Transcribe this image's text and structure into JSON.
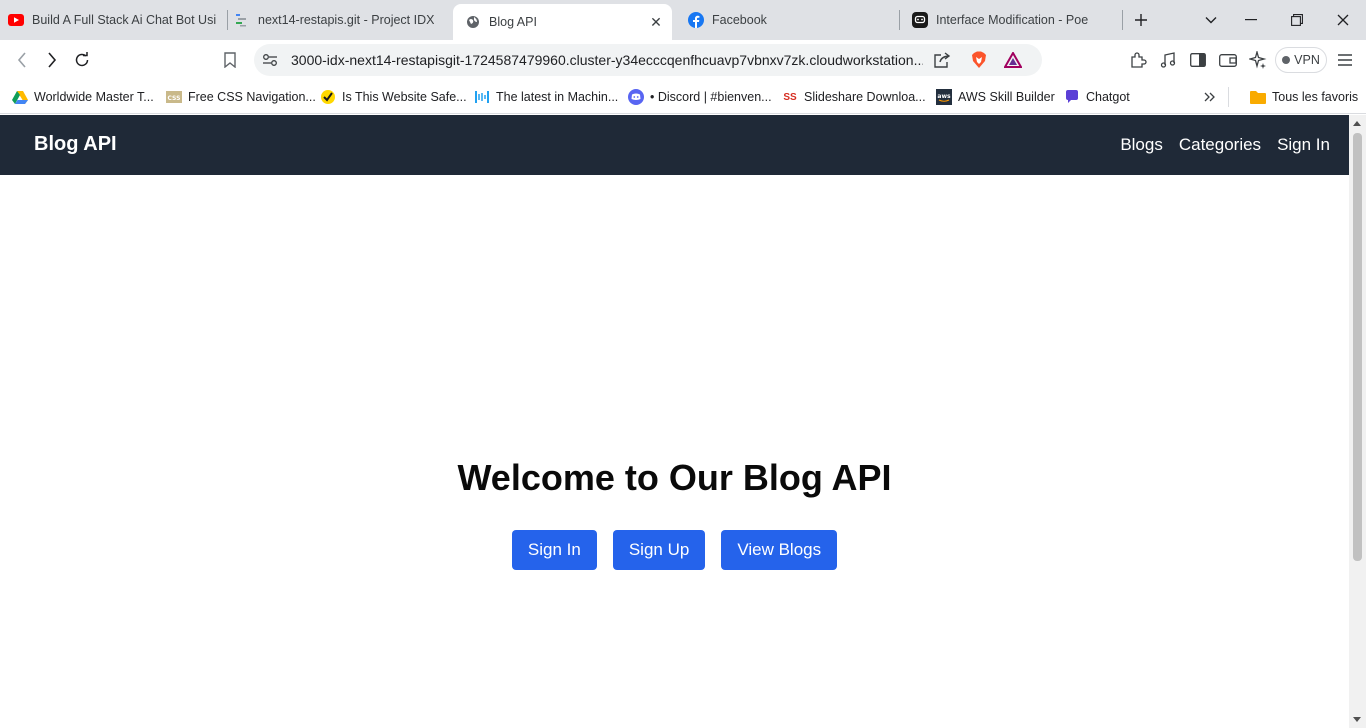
{
  "browser": {
    "tabs": [
      {
        "title": "Build A Full Stack Ai Chat Bot Usi",
        "icon": "youtube-icon"
      },
      {
        "title": "next14-restapis.git - Project IDX",
        "icon": "idx-icon"
      },
      {
        "title": "Blog API",
        "icon": "globe-icon",
        "active": true
      },
      {
        "title": "Facebook",
        "icon": "facebook-icon"
      },
      {
        "title": "Interface Modification - Poe",
        "icon": "poe-icon"
      }
    ],
    "url": "3000-idx-next14-restapisgit-1724587479960.cluster-y34ecccqenfhcuavp7vbnxv7zk.cloudworkstation...",
    "vpn_label": "VPN",
    "bookmarks": [
      {
        "label": "Worldwide Master T...",
        "icon": "google-drive-icon"
      },
      {
        "label": "Free CSS Navigation...",
        "icon": "css-icon"
      },
      {
        "label": "Is This Website Safe...",
        "icon": "norton-check-icon"
      },
      {
        "label": "The latest in Machin...",
        "icon": "papers-icon"
      },
      {
        "label": "• Discord | #bienven...",
        "icon": "discord-icon"
      },
      {
        "label": "Slideshare Downloa...",
        "icon": "slideshare-icon"
      },
      {
        "label": "AWS Skill Builder",
        "icon": "aws-icon"
      },
      {
        "label": "Chatgot",
        "icon": "chatgot-icon"
      }
    ],
    "all_bookmarks_label": "Tous les favoris",
    "colors": {
      "tabstrip": "#dfe1e5",
      "omnibox": "#f1f3f4"
    }
  },
  "site": {
    "brand": "Blog API",
    "nav": {
      "blogs": "Blogs",
      "categories": "Categories",
      "sign_in": "Sign In"
    },
    "hero": {
      "title": "Welcome to Our Blog API",
      "buttons": {
        "sign_in": "Sign In",
        "sign_up": "Sign Up",
        "view_blogs": "View Blogs"
      }
    },
    "colors": {
      "navbar": "#1f2937",
      "button": "#2563eb"
    }
  }
}
